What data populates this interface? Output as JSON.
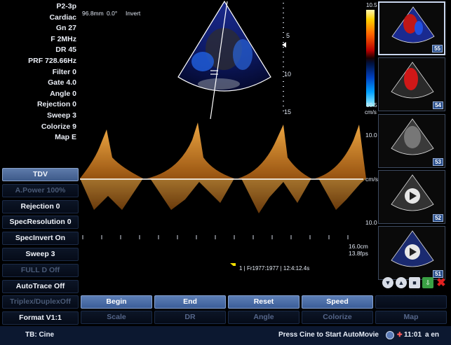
{
  "params": [
    "P2-3p",
    "Cardiac",
    "Gn 27",
    "F 2MHz",
    "DR 45",
    "PRF 728.66Hz",
    "Filter 0",
    "Gate 4.0",
    "Angle 0",
    "Rejection 0",
    "Sweep 3",
    "Colorize 9",
    "Map E"
  ],
  "header": {
    "depth": "96.8mm",
    "angle": "0.0°",
    "invert": "Invert"
  },
  "scale": {
    "top": "10.5",
    "bottom": "10.5",
    "unit": "cm/s",
    "depth_ticks": [
      "5",
      "10",
      "15"
    ]
  },
  "spectrum": {
    "ticks": [
      "10.0",
      "cm/s",
      "10.0"
    ],
    "depth": "16.0cm",
    "fps": "13.8fps"
  },
  "cine": "1 | Fr1977:1977 | 12:4:12.4s",
  "menu": [
    {
      "label": "TDV",
      "state": "active"
    },
    {
      "label": "A.Power 100%",
      "state": "dim"
    },
    {
      "label": "Rejection  0",
      "state": "normal"
    },
    {
      "label": "SpecResolution  0",
      "state": "normal"
    },
    {
      "label": "SpecInvert  On",
      "state": "normal"
    },
    {
      "label": "Sweep  3",
      "state": "normal"
    },
    {
      "label": "FULL D  Off",
      "state": "dim"
    },
    {
      "label": "AutoTrace  Off",
      "state": "normal"
    },
    {
      "label": "Triplex/DuplexOff",
      "state": "dim"
    },
    {
      "label": "Format  V1:1",
      "state": "normal"
    }
  ],
  "buttons_row1": [
    "Begin",
    "End",
    "Reset",
    "Speed",
    ""
  ],
  "buttons_row2": [
    "Scale",
    "DR",
    "Angle",
    "Colorize",
    "Map"
  ],
  "thumbs": [
    "55",
    "54",
    "53",
    "52",
    "51"
  ],
  "status": {
    "left": "TB: Cine",
    "center": "Press Cine to Start AutoMovie",
    "time": "11:01",
    "lang": "a  en"
  }
}
